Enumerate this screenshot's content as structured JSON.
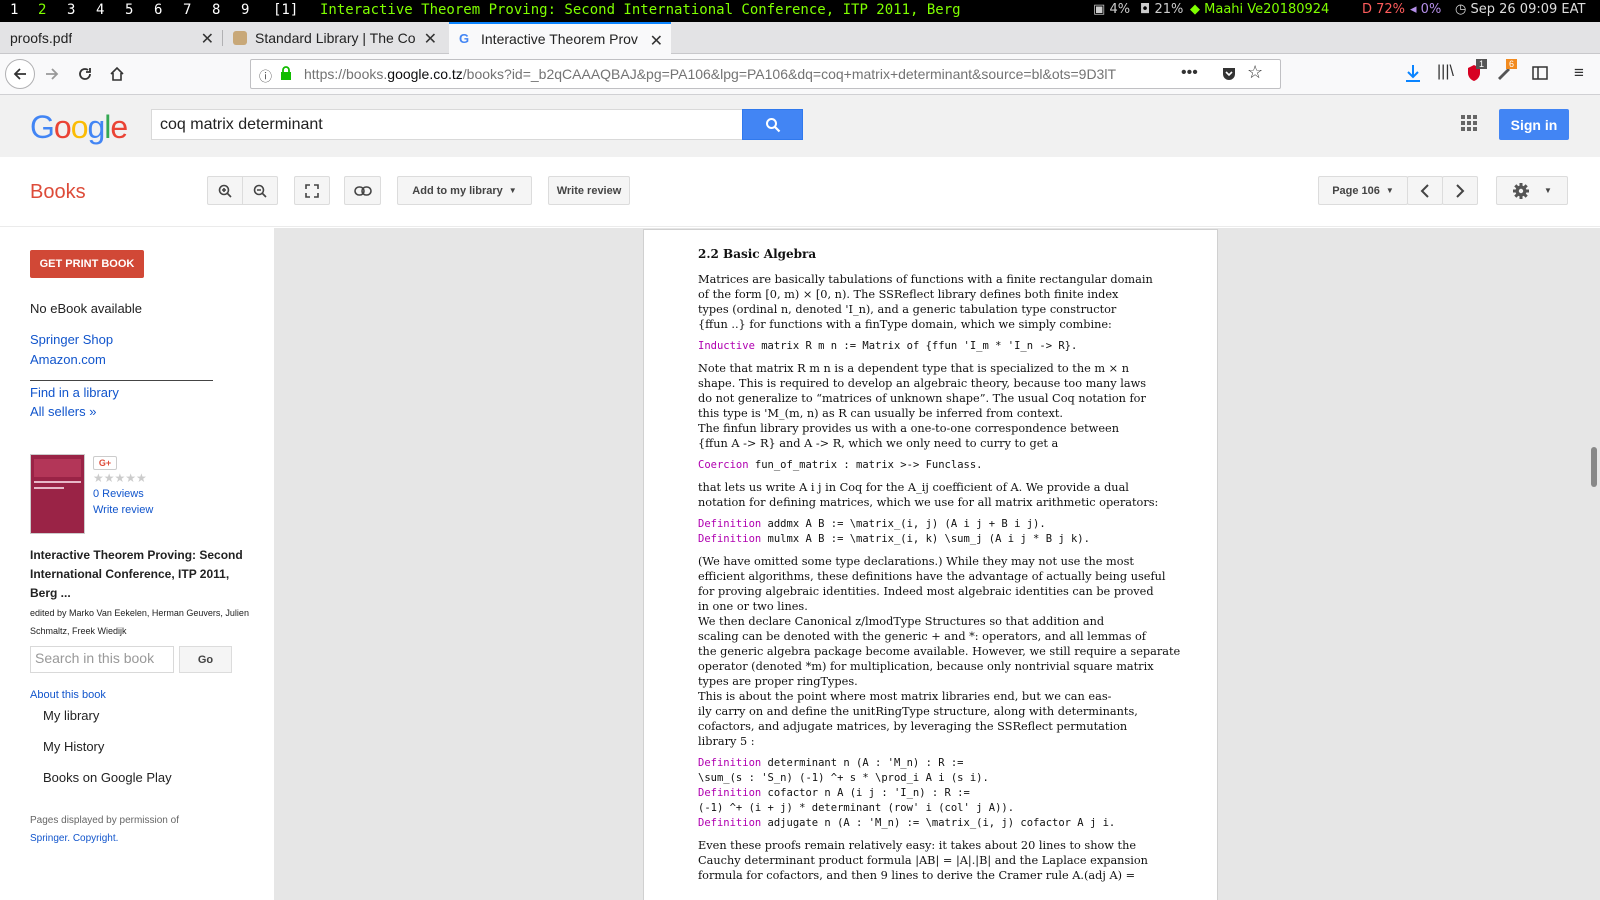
{
  "i3bar": {
    "workspaces": [
      "1",
      "2",
      "3",
      "4",
      "5",
      "6",
      "7",
      "8",
      "9",
      "[1]"
    ],
    "active_workspace": "2",
    "window_title": "Interactive Theorem Proving: Second International Conference, ITP 2011, Berg",
    "cpu": "4%",
    "disk": "21%",
    "wifi": "Maahi Ve20180924",
    "battery": "D 72%",
    "volume": "0%",
    "datetime": "Sep 26 09:09 EAT"
  },
  "tabs": [
    {
      "label": "proofs.pdf",
      "icon": "pdf-icon"
    },
    {
      "label": "Standard Library | The Co",
      "icon": "rooster-icon"
    },
    {
      "label": "Interactive Theorem Prov",
      "icon": "google-icon"
    }
  ],
  "address": {
    "url_prefix": "https://books.",
    "url_domain": "google.co.tz",
    "url_rest": "/books?id=_b2qCAAAQBAJ&pg=PA106&lpg=PA106&dq=coq+matrix+determinant&source=bl&ots=9D3lT",
    "downloads_badge": "",
    "shield_badge": "1",
    "extension_badge": "6"
  },
  "google": {
    "logo": "Google",
    "search_value": "coq matrix determinant",
    "signin_label": "Sign in"
  },
  "books_toolbar": {
    "books_label": "Books",
    "add_library_label": "Add to my library",
    "write_review_label": "Write review",
    "page_label": "Page 106"
  },
  "sidebar": {
    "get_print_label": "GET PRINT BOOK",
    "no_ebook": "No eBook available",
    "springer_shop": "Springer Shop",
    "amazon": "Amazon.com",
    "find_library": "Find in a library",
    "all_sellers": "All sellers »",
    "reviews_count": "0 Reviews",
    "write_review": "Write review",
    "book_title": "Interactive Theorem Proving: Second International Conference, ITP 2011, Berg ...",
    "book_editors": "edited by Marko Van Eekelen, Herman Geuvers, Julien Schmaltz, Freek Wiedijk",
    "search_placeholder": "Search in this book",
    "go_label": "Go",
    "about_book": "About this book",
    "my_library": "My library",
    "my_history": "My History",
    "books_on_play": "Books on Google Play",
    "permission_text": "Pages displayed by permission of",
    "springer_link": "Springer",
    "copyright_link": "Copyright"
  },
  "page_content": {
    "heading": "2.2    Basic Algebra",
    "lines": [
      "Matrices are basically tabulations of functions with a finite rectangular domain",
      "of the form [0, m) × [0, n). The SSReflect library defines both finite index",
      "types (ordinal n, denoted 'I_n), and a generic tabulation type constructor",
      "{ffun ..} for functions with a finType domain, which we simply combine:"
    ],
    "code1_kw": "Inductive",
    "code1": " matrix R m n := Matrix of {ffun 'I_m * 'I_n -> R}.",
    "para2": [
      "Note that matrix R m n is a dependent type that is specialized to the m × n",
      "shape. This is required to develop an algebraic theory, because too many laws",
      "do not generalize to “matrices of unknown shape”. The usual Coq notation for",
      "this type is 'M_(m, n) as R can usually be inferred from context.",
      "    The finfun library provides us with a one-to-one correspondence between",
      "{ffun A -> R} and A -> R, which we only need to curry to get a"
    ],
    "code2_kw": "Coercion",
    "code2": " fun_of_matrix : matrix >-> Funclass.",
    "para3": [
      "that lets us write A i j in Coq for the A_ij coefficient of A. We provide a dual",
      "notation for defining matrices, which we use for all matrix arithmetic operators:"
    ],
    "code3": [
      {
        "kw": "Definition",
        "text": " addmx A B := \\matrix_(i, j) (A i j + B i j)."
      },
      {
        "kw": "Definition",
        "text": " mulmx A B := \\matrix_(i, k) \\sum_j (A i j * B j k)."
      }
    ],
    "para4": [
      "(We have omitted some type declarations.) While they may not use the most",
      "efficient algorithms, these definitions have the advantage of actually being useful",
      "for proving algebraic identities. Indeed most algebraic identities can be proved",
      "in one or two lines.",
      "    We then declare Canonical z/lmodType Structures so that addition and",
      "scaling can be denoted with the generic + and *: operators, and all lemmas of",
      "the generic algebra package become available. However, we still require a separate",
      "operator (denoted *m) for multiplication, because only nontrivial square matrix",
      "types are proper ringTypes.",
      "    This is about the point where most matrix libraries end, but we can eas-",
      "ily carry on and define the unitRingType structure, along with determinants,",
      "cofactors, and adjugate matrices, by leveraging the SSReflect permutation",
      "library 5 :"
    ],
    "code4": [
      {
        "kw": "Definition",
        "text": " determinant n (A : 'M_n) : R :="
      },
      {
        "kw": "",
        "text": "  \\sum_(s : 'S_n) (-1) ^+ s * \\prod_i A i (s i)."
      },
      {
        "kw": "Definition",
        "text": " cofactor n A (i j : 'I_n) : R :="
      },
      {
        "kw": "",
        "text": "  (-1) ^+ (i + j) * determinant (row' i (col' j A))."
      },
      {
        "kw": "Definition",
        "text": " adjugate n (A : 'M_n) := \\matrix_(i, j) cofactor A j i."
      }
    ],
    "para5": [
      "Even these proofs remain relatively easy: it takes about 20 lines to show the",
      "Cauchy determinant product formula |AB| = |A|.|B| and the Laplace expansion",
      "formula for cofactors, and then 9 lines to derive the Cramer rule A.(adj A) ="
    ]
  },
  "colors": {
    "accent": "#4285f4",
    "books_red": "#dd4b39",
    "print_button": "#d14836",
    "link": "#1155cc",
    "keyword": "#b000b0",
    "i3_green": "#7fff00"
  }
}
